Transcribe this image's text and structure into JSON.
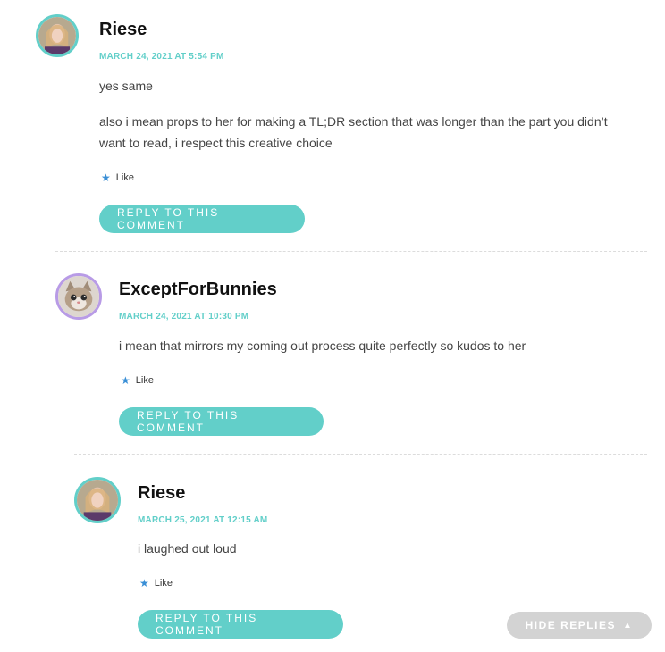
{
  "comments": [
    {
      "author": "Riese",
      "date": "MARCH 24, 2021 AT 5:54 PM",
      "paragraphs": [
        "yes same",
        "also i mean props to her for making a TL;DR section that was longer than the part you didn’t want to read, i respect this creative choice"
      ],
      "like_label": "Like",
      "reply_label": "REPLY TO THIS COMMENT"
    },
    {
      "author": "ExceptForBunnies",
      "date": "MARCH 24, 2021 AT 10:30 PM",
      "paragraphs": [
        "i mean that mirrors my coming out process quite perfectly so kudos to her"
      ],
      "like_label": "Like",
      "reply_label": "REPLY TO THIS COMMENT"
    },
    {
      "author": "Riese",
      "date": "MARCH 25, 2021 AT 12:15 AM",
      "paragraphs": [
        "i laughed out loud"
      ],
      "like_label": "Like",
      "reply_label": "REPLY TO THIS COMMENT"
    }
  ],
  "hide_replies_label": "HIDE REPLIES",
  "icons": {
    "like": "star-icon",
    "hide_replies": "triangle-up-icon"
  },
  "colors": {
    "accent": "#62cfc9",
    "avatar_border_alt": "#b89be6",
    "hide_button": "#d3d3d3"
  }
}
